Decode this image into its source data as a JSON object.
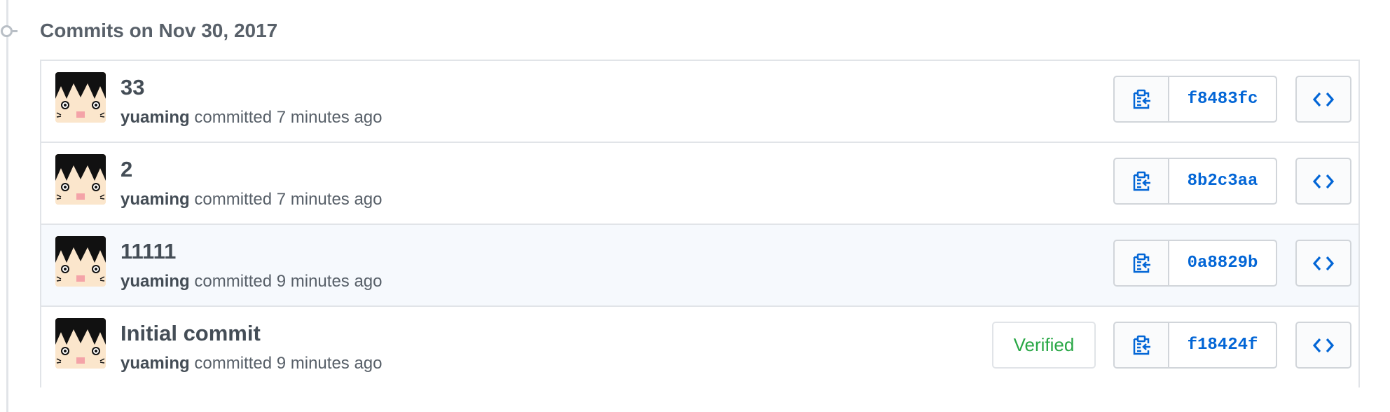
{
  "group": {
    "title": "Commits on Nov 30, 2017"
  },
  "commits": [
    {
      "message": "33",
      "author": "yuaming",
      "action": "committed",
      "time": "7 minutes ago",
      "sha": "f8483fc",
      "verified": ""
    },
    {
      "message": "2",
      "author": "yuaming",
      "action": "committed",
      "time": "7 minutes ago",
      "sha": "8b2c3aa",
      "verified": ""
    },
    {
      "message": "11111",
      "author": "yuaming",
      "action": "committed",
      "time": "9 minutes ago",
      "sha": "0a8829b",
      "verified": ""
    },
    {
      "message": "Initial commit",
      "author": "yuaming",
      "action": "committed",
      "time": "9 minutes ago",
      "sha": "f18424f",
      "verified": "Verified"
    }
  ],
  "icons": {
    "copy": "clippy-icon",
    "browse": "code-icon",
    "commit": "git-commit-icon"
  },
  "colors": {
    "link": "#0366d6",
    "verified": "#28a745",
    "hover_row": "#f6f9fd"
  }
}
